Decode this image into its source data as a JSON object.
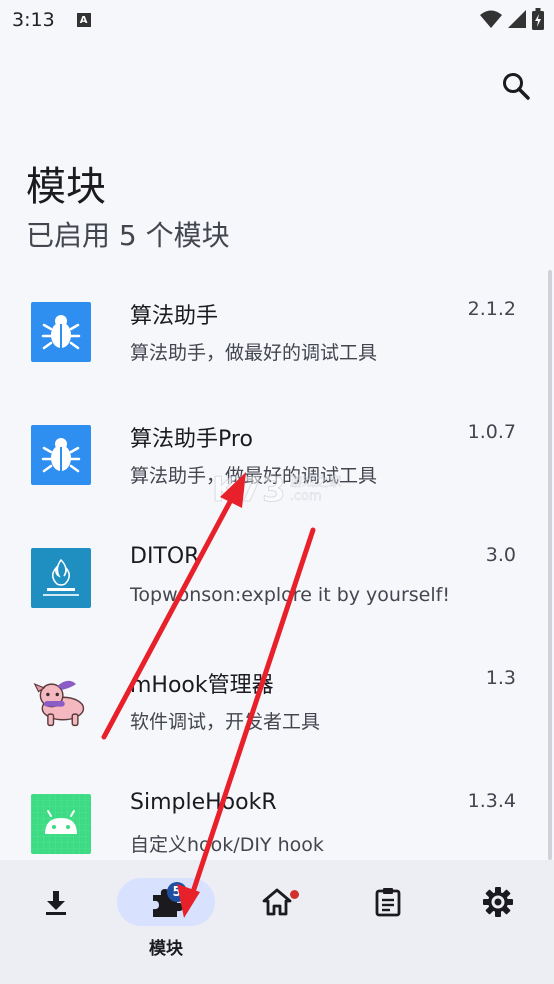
{
  "status_bar": {
    "time": "3:13",
    "a_glyph": "A"
  },
  "header": {
    "title": "模块",
    "subtitle": "已启用 5 个模块"
  },
  "modules": [
    {
      "name": "算法助手",
      "description": "算法助手，做最好的调试工具",
      "version": "2.1.2",
      "icon": "bug-icon"
    },
    {
      "name": "算法助手Pro",
      "description": "算法助手，做最好的调试工具",
      "version": "1.0.7",
      "icon": "bug-icon"
    },
    {
      "name": "DITOR",
      "description": "Topwonson:explore it by yourself!",
      "version": "3.0",
      "icon": "ditor-logo-icon"
    },
    {
      "name": "mHook管理器",
      "description": "软件调试，开发者工具",
      "version": "1.3",
      "icon": "dog-mascot-icon"
    },
    {
      "name": "SimpleHookR",
      "description": "自定义hook/DIY hook",
      "version": "1.3.4",
      "icon": "android-icon"
    }
  ],
  "nav": {
    "active_label": "模块",
    "badge_count": "5",
    "items": [
      "download-icon",
      "puzzle-icon",
      "home-icon",
      "clipboard-icon",
      "gear-icon"
    ]
  },
  "watermark": {
    "logo": "K73",
    "line1": "游戏之家",
    "line2": ".com"
  },
  "colors": {
    "accent_pill": "#d8e2ff",
    "badge": "#1f4fa0",
    "annotation_arrow": "#e8202a",
    "bug_icon_bg": "#2f8ff0"
  }
}
